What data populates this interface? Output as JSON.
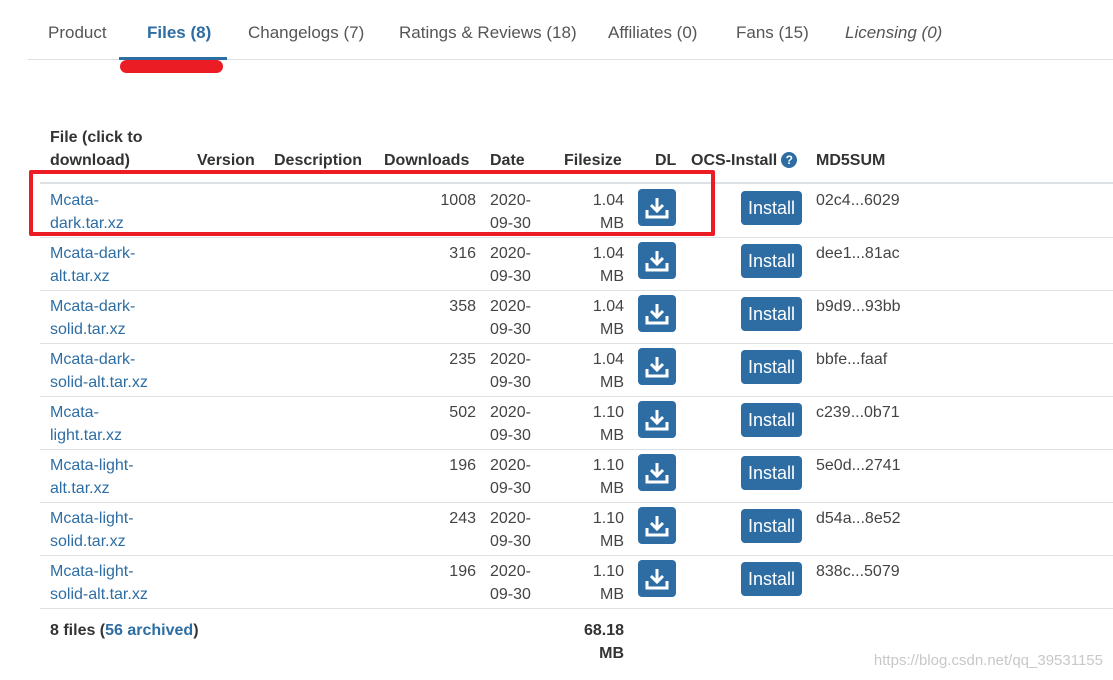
{
  "tabs": [
    {
      "label": "Product"
    },
    {
      "label": "Files (8)"
    },
    {
      "label": "Changelogs (7)"
    },
    {
      "label": "Ratings & Reviews (18)"
    },
    {
      "label": "Affiliates (0)"
    },
    {
      "label": "Fans (15)"
    },
    {
      "label": "Licensing (0)"
    }
  ],
  "table": {
    "headers": {
      "file_line1": "File (click to",
      "file_line2": "download)",
      "version": "Version",
      "description": "Description",
      "downloads": "Downloads",
      "date": "Date",
      "filesize": "Filesize",
      "dl": "DL",
      "ocs_install": "OCS-Install",
      "help_icon": "?",
      "md5": "MD5SUM"
    },
    "install_label": "Install",
    "rows": [
      {
        "name_line1": "Mcata-",
        "name_line2": "dark.tar.xz",
        "downloads": "1008",
        "date_line1": "2020-",
        "date_line2": "09-30",
        "size_line1": "1.04",
        "size_line2": "MB",
        "md5": "02c4...6029"
      },
      {
        "name_line1": "Mcata-dark-",
        "name_line2": "alt.tar.xz",
        "downloads": "316",
        "date_line1": "2020-",
        "date_line2": "09-30",
        "size_line1": "1.04",
        "size_line2": "MB",
        "md5": "dee1...81ac"
      },
      {
        "name_line1": "Mcata-dark-",
        "name_line2": "solid.tar.xz",
        "downloads": "358",
        "date_line1": "2020-",
        "date_line2": "09-30",
        "size_line1": "1.04",
        "size_line2": "MB",
        "md5": "b9d9...93bb"
      },
      {
        "name_line1": "Mcata-dark-",
        "name_line2": "solid-alt.tar.xz",
        "downloads": "235",
        "date_line1": "2020-",
        "date_line2": "09-30",
        "size_line1": "1.04",
        "size_line2": "MB",
        "md5": "bbfe...faaf"
      },
      {
        "name_line1": "Mcata-",
        "name_line2": "light.tar.xz",
        "downloads": "502",
        "date_line1": "2020-",
        "date_line2": "09-30",
        "size_line1": "1.10",
        "size_line2": "MB",
        "md5": "c239...0b71"
      },
      {
        "name_line1": "Mcata-light-",
        "name_line2": "alt.tar.xz",
        "downloads": "196",
        "date_line1": "2020-",
        "date_line2": "09-30",
        "size_line1": "1.10",
        "size_line2": "MB",
        "md5": "5e0d...2741"
      },
      {
        "name_line1": "Mcata-light-",
        "name_line2": "solid.tar.xz",
        "downloads": "243",
        "date_line1": "2020-",
        "date_line2": "09-30",
        "size_line1": "1.10",
        "size_line2": "MB",
        "md5": "d54a...8e52"
      },
      {
        "name_line1": "Mcata-light-",
        "name_line2": "solid-alt.tar.xz",
        "downloads": "196",
        "date_line1": "2020-",
        "date_line2": "09-30",
        "size_line1": "1.10",
        "size_line2": "MB",
        "md5": "838c...5079"
      }
    ]
  },
  "footer": {
    "files_prefix": "8 files (",
    "archived_link": "56 archived",
    "files_suffix": ")",
    "total_size_line1": "68.18",
    "total_size_line2": "MB"
  },
  "watermark": "https://blog.csdn.net/qq_39531155",
  "colors": {
    "accent": "#2d6da3",
    "highlight": "#ec1c24"
  },
  "icons": {
    "download": "download-icon",
    "help": "help-circle-icon"
  }
}
